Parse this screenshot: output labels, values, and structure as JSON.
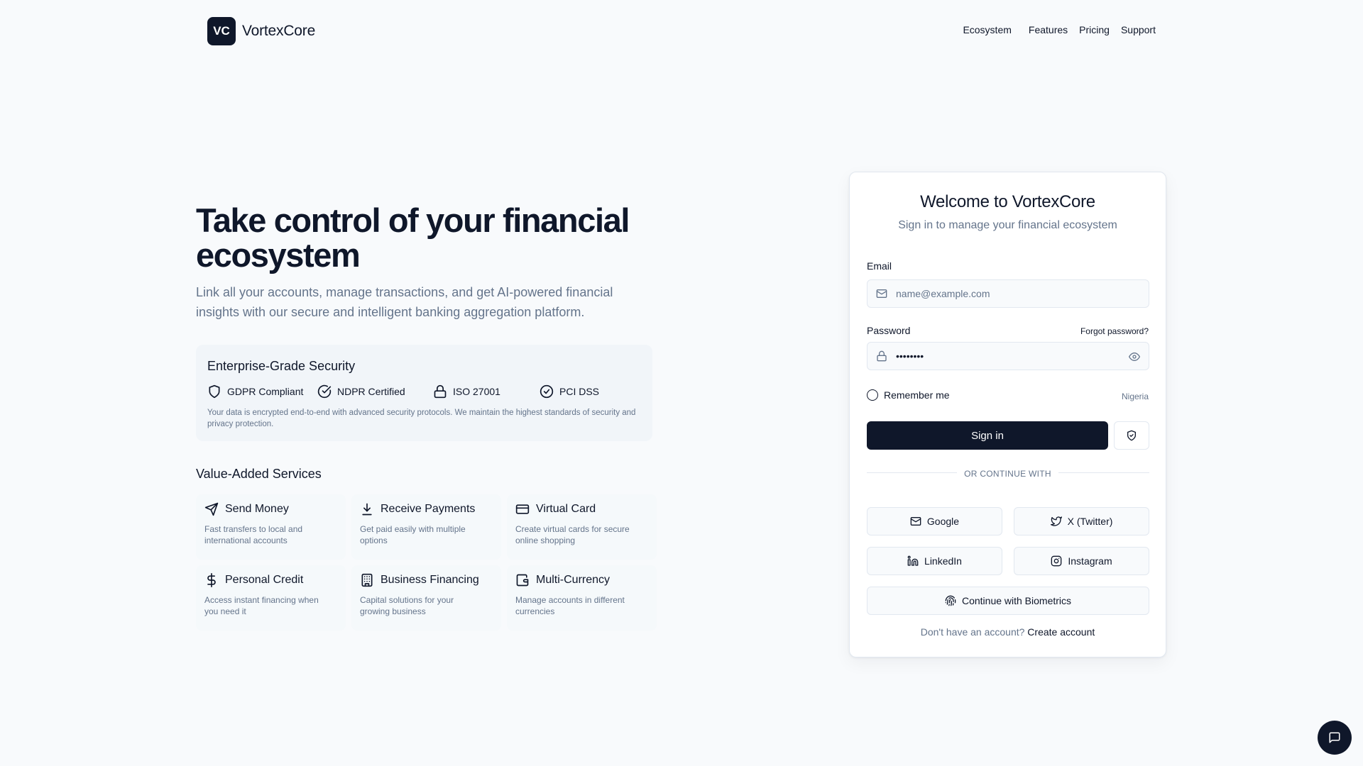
{
  "brand": {
    "mark": "VC",
    "name": "VortexCore"
  },
  "nav": {
    "items": [
      "Ecosystem",
      "Features",
      "Pricing",
      "Support"
    ]
  },
  "hero": {
    "title": "Take control of your financial ecosystem",
    "subtitle": "Link all your accounts, manage transactions, and get AI-powered financial insights with our secure and intelligent banking aggregation platform."
  },
  "security": {
    "title": "Enterprise-Grade Security",
    "badges": [
      {
        "label": "GDPR Compliant",
        "icon": "shield-icon"
      },
      {
        "label": "NDPR Certified",
        "icon": "check-circle-icon"
      },
      {
        "label": "ISO 27001",
        "icon": "lock-icon"
      },
      {
        "label": "PCI DSS",
        "icon": "check-circle-icon"
      }
    ],
    "note": "Your data is encrypted end-to-end with advanced security protocols. We maintain the highest standards of security and privacy protection."
  },
  "services": {
    "title": "Value-Added Services",
    "items": [
      {
        "name": "Send Money",
        "desc": "Fast transfers to local and international accounts",
        "icon": "send-icon"
      },
      {
        "name": "Receive Payments",
        "desc": "Get paid easily with multiple options",
        "icon": "download-icon"
      },
      {
        "name": "Virtual Card",
        "desc": "Create virtual cards for secure online shopping",
        "icon": "credit-card-icon"
      },
      {
        "name": "Personal Credit",
        "desc": "Access instant financing when you need it",
        "icon": "dollar-icon"
      },
      {
        "name": "Business Financing",
        "desc": "Capital solutions for your growing business",
        "icon": "building-icon"
      },
      {
        "name": "Multi-Currency",
        "desc": "Manage accounts in different currencies",
        "icon": "wallet-icon"
      }
    ]
  },
  "login": {
    "title": "Welcome to VortexCore",
    "subtitle": "Sign in to manage your financial ecosystem",
    "email_label": "Email",
    "email_placeholder": "name@example.com",
    "password_label": "Password",
    "password_value": "password",
    "forgot": "Forgot password?",
    "remember": "Remember me",
    "region": "Nigeria",
    "signin": "Sign in",
    "divider": "OR CONTINUE WITH",
    "providers": [
      "Google",
      "X (Twitter)",
      "LinkedIn",
      "Instagram"
    ],
    "biometrics": "Continue with Biometrics",
    "signup_prompt": "Don't have an account?",
    "signup_link": "Create account"
  },
  "colors": {
    "primary": "#0f172a",
    "muted": "#64748b",
    "border": "#e2e8f0",
    "background": "#f8fafc"
  }
}
